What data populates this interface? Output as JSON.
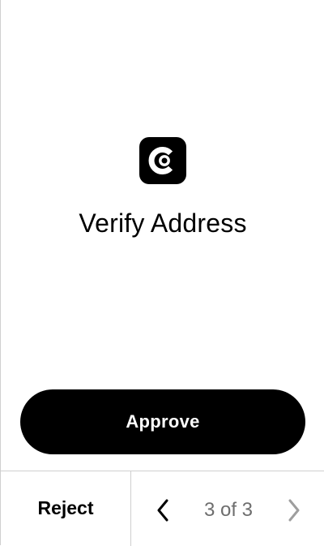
{
  "screen": {
    "title": "Verify Address",
    "app_icon": "app-logo-icon"
  },
  "actions": {
    "approve_label": "Approve",
    "reject_label": "Reject"
  },
  "pagination": {
    "current": 3,
    "total": 3,
    "label": "3 of 3",
    "prev_icon": "chevron-left-icon",
    "next_icon": "chevron-right-icon",
    "next_enabled": false
  },
  "colors": {
    "primary": "#000000",
    "on_primary": "#ffffff",
    "muted_text": "#6e6e6e",
    "disabled_icon": "#9e9e9e",
    "divider": "#cfcfcf"
  }
}
